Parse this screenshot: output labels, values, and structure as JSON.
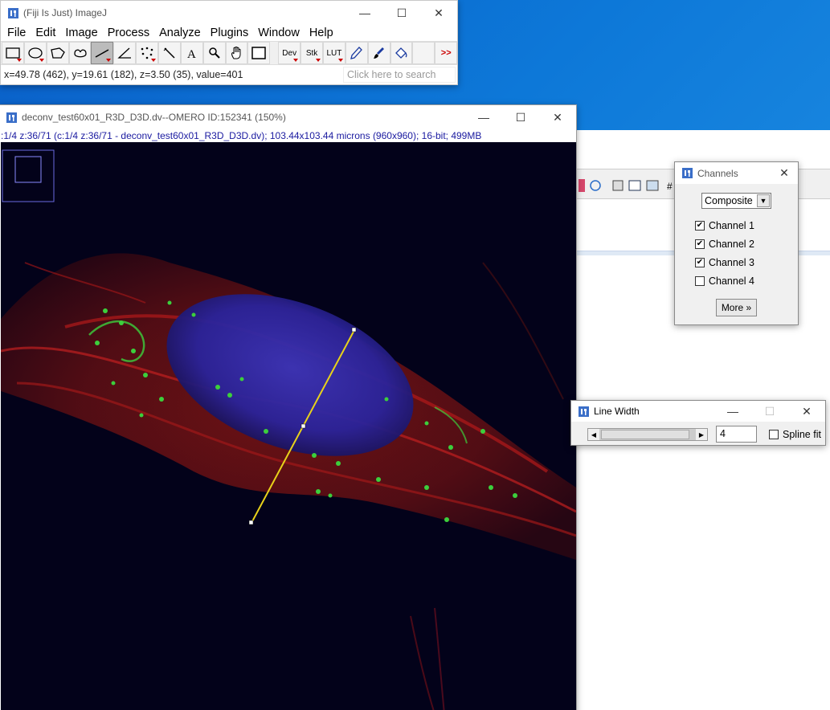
{
  "imagej": {
    "title": "(Fiji Is Just) ImageJ",
    "menu": [
      "File",
      "Edit",
      "Image",
      "Process",
      "Analyze",
      "Plugins",
      "Window",
      "Help"
    ],
    "tools": {
      "dev": "Dev",
      "stk": "Stk",
      "lut": "LUT",
      "more": ">>"
    },
    "status": "x=49.78 (462), y=19.61 (182), z=3.50 (35), value=401",
    "search_placeholder": "Click here to search"
  },
  "image_window": {
    "title": "deconv_test60x01_R3D_D3D.dv--OMERO ID:152341 (150%)",
    "subtitle": ":1/4 z:36/71 (c:1/4 z:36/71 - deconv_test60x01_R3D_D3D.dv); 103.44x103.44 microns (960x960); 16-bit; 499MB"
  },
  "channels": {
    "title": "Channels",
    "mode": "Composite",
    "items": [
      {
        "label": "Channel 1",
        "checked": true
      },
      {
        "label": "Channel 2",
        "checked": true
      },
      {
        "label": "Channel 3",
        "checked": true
      },
      {
        "label": "Channel 4",
        "checked": false
      }
    ],
    "more_label": "More »"
  },
  "line_width": {
    "title": "Line Width",
    "value": "4",
    "spline_label": "Spline fit",
    "spline_checked": false
  },
  "colors": {
    "accent": "#0a5fc8",
    "line_roi": "#e8d21a"
  }
}
